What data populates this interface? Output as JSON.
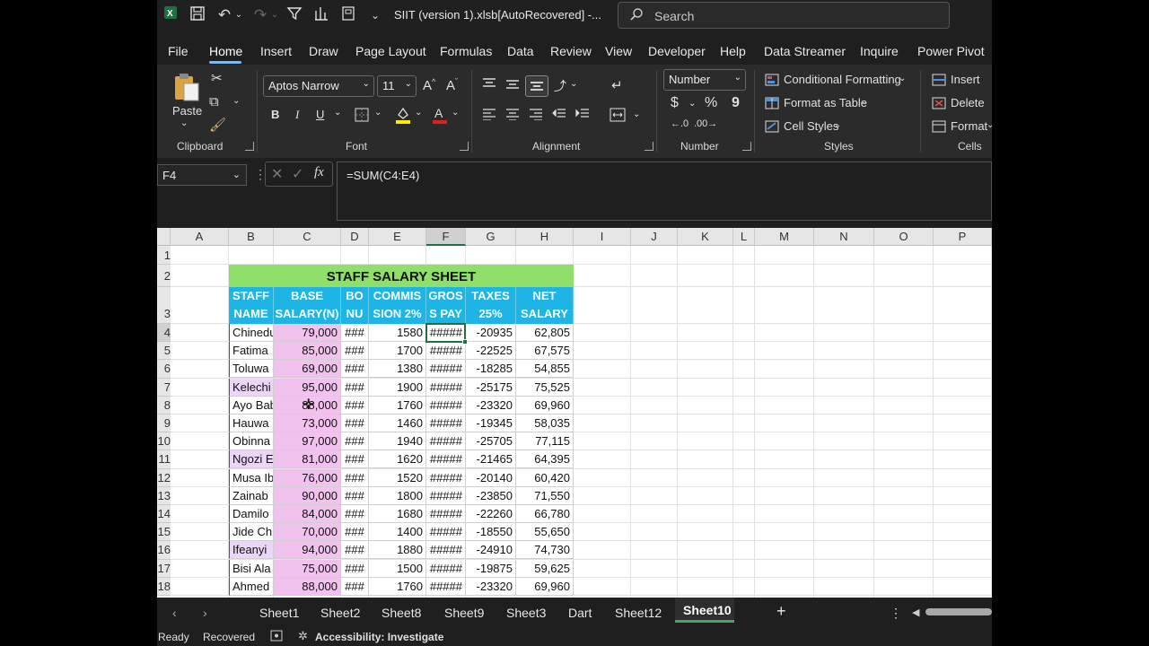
{
  "titlebar": {
    "title": "SIIT (version 1).xlsb[AutoRecovered]  -...",
    "search_placeholder": "Search",
    "icons": [
      "excel-logo-icon",
      "save-icon",
      "undo-icon",
      "redo-icon",
      "filter-icon",
      "columns-icon",
      "form-icon",
      "customize-icon"
    ]
  },
  "menu": {
    "tabs": [
      "File",
      "Home",
      "Insert",
      "Draw",
      "Page Layout",
      "Formulas",
      "Data",
      "Review",
      "View",
      "Developer",
      "Help",
      "Data Streamer",
      "Inquire",
      "Power Pivot"
    ],
    "active": "Home"
  },
  "ribbon": {
    "clipboard": {
      "paste": "Paste",
      "label": "Clipboard"
    },
    "font": {
      "name": "Aptos Narrow",
      "size": "11",
      "bold": "B",
      "italic": "I",
      "underline": "U",
      "label": "Font"
    },
    "alignment": {
      "label": "Alignment"
    },
    "number": {
      "format": "Number",
      "currency": "$",
      "percent": "%",
      "comma": "9",
      "label": "Number"
    },
    "styles": {
      "conditional": "Conditional Formatting",
      "table": "Format as Table",
      "cell_styles": "Cell Styles",
      "label": "Styles"
    },
    "cells": {
      "insert": "Insert",
      "delete": "Delete",
      "format": "Format",
      "label": "Cells"
    }
  },
  "formula_bar": {
    "name_box": "F4",
    "fx": "fx",
    "formula": "=SUM(C4:E4)"
  },
  "grid": {
    "columns": [
      "A",
      "B",
      "C",
      "D",
      "E",
      "F",
      "G",
      "H",
      "I",
      "J",
      "K",
      "L",
      "M",
      "N",
      "O",
      "P"
    ],
    "selected_column": "F",
    "title": "STAFF SALARY SHEET",
    "headers": [
      [
        "STAFF",
        "NAME"
      ],
      [
        "BASE",
        "SALARY(N)"
      ],
      [
        "BO",
        "NU"
      ],
      [
        "COMMIS",
        "SION 2%"
      ],
      [
        "GROS",
        "S PAY"
      ],
      [
        "TAXES",
        "25%"
      ],
      [
        "NET",
        "SALARY"
      ]
    ],
    "rows": [
      {
        "row": "4",
        "name": "Chinedu",
        "base": "79,000",
        "bonus": "###",
        "commission": "1580",
        "gross": "#####",
        "taxes": "-20935",
        "net": "62,805"
      },
      {
        "row": "5",
        "name": "Fatima",
        "base": "85,000",
        "bonus": "###",
        "commission": "1700",
        "gross": "#####",
        "taxes": "-22525",
        "net": "67,575"
      },
      {
        "row": "6",
        "name": "Toluwa",
        "base": "69,000",
        "bonus": "###",
        "commission": "1380",
        "gross": "#####",
        "taxes": "-18285",
        "net": "54,855"
      },
      {
        "row": "7",
        "name": "Kelechi",
        "base": "95,000",
        "bonus": "###",
        "commission": "1900",
        "gross": "#####",
        "taxes": "-25175",
        "net": "75,525"
      },
      {
        "row": "8",
        "name": "Ayo Bab",
        "base": "88,000",
        "bonus": "###",
        "commission": "1760",
        "gross": "#####",
        "taxes": "-23320",
        "net": "69,960"
      },
      {
        "row": "9",
        "name": "Hauwa",
        "base": "73,000",
        "bonus": "###",
        "commission": "1460",
        "gross": "#####",
        "taxes": "-19345",
        "net": "58,035"
      },
      {
        "row": "10",
        "name": "Obinna",
        "base": "97,000",
        "bonus": "###",
        "commission": "1940",
        "gross": "#####",
        "taxes": "-25705",
        "net": "77,115"
      },
      {
        "row": "11",
        "name": "Ngozi E",
        "base": "81,000",
        "bonus": "###",
        "commission": "1620",
        "gross": "#####",
        "taxes": "-21465",
        "net": "64,395"
      },
      {
        "row": "12",
        "name": "Musa Ib",
        "base": "76,000",
        "bonus": "###",
        "commission": "1520",
        "gross": "#####",
        "taxes": "-20140",
        "net": "60,420"
      },
      {
        "row": "13",
        "name": "Zainab",
        "base": "90,000",
        "bonus": "###",
        "commission": "1800",
        "gross": "#####",
        "taxes": "-23850",
        "net": "71,550"
      },
      {
        "row": "14",
        "name": "Damilo",
        "base": "84,000",
        "bonus": "###",
        "commission": "1680",
        "gross": "#####",
        "taxes": "-22260",
        "net": "66,780"
      },
      {
        "row": "15",
        "name": "Jide Chu",
        "base": "70,000",
        "bonus": "###",
        "commission": "1400",
        "gross": "#####",
        "taxes": "-18550",
        "net": "55,650"
      },
      {
        "row": "16",
        "name": "Ifeanyi",
        "base": "94,000",
        "bonus": "###",
        "commission": "1880",
        "gross": "#####",
        "taxes": "-24910",
        "net": "74,730"
      },
      {
        "row": "17",
        "name": "Bisi Ala",
        "base": "75,000",
        "bonus": "###",
        "commission": "1500",
        "gross": "#####",
        "taxes": "-19875",
        "net": "59,625"
      },
      {
        "row": "18",
        "name": "Ahmed",
        "base": "88,000",
        "bonus": "###",
        "commission": "1760",
        "gross": "#####",
        "taxes": "-23320",
        "net": "69,960"
      }
    ],
    "colors": {
      "title_bg": "#8ee06a",
      "header_bg": "#1fb4e6",
      "base_bg": "#f2c2ee",
      "selection": "#1e7145"
    }
  },
  "sheets": {
    "tabs": [
      "Sheet1",
      "Sheet2",
      "Sheet8",
      "Sheet9",
      "Sheet3",
      "Dart",
      "Sheet12",
      "Sheet10"
    ],
    "active": "Sheet10",
    "add": "+"
  },
  "status": {
    "ready": "Ready",
    "recovered": "Recovered",
    "accessibility": "Accessibility: Investigate"
  }
}
